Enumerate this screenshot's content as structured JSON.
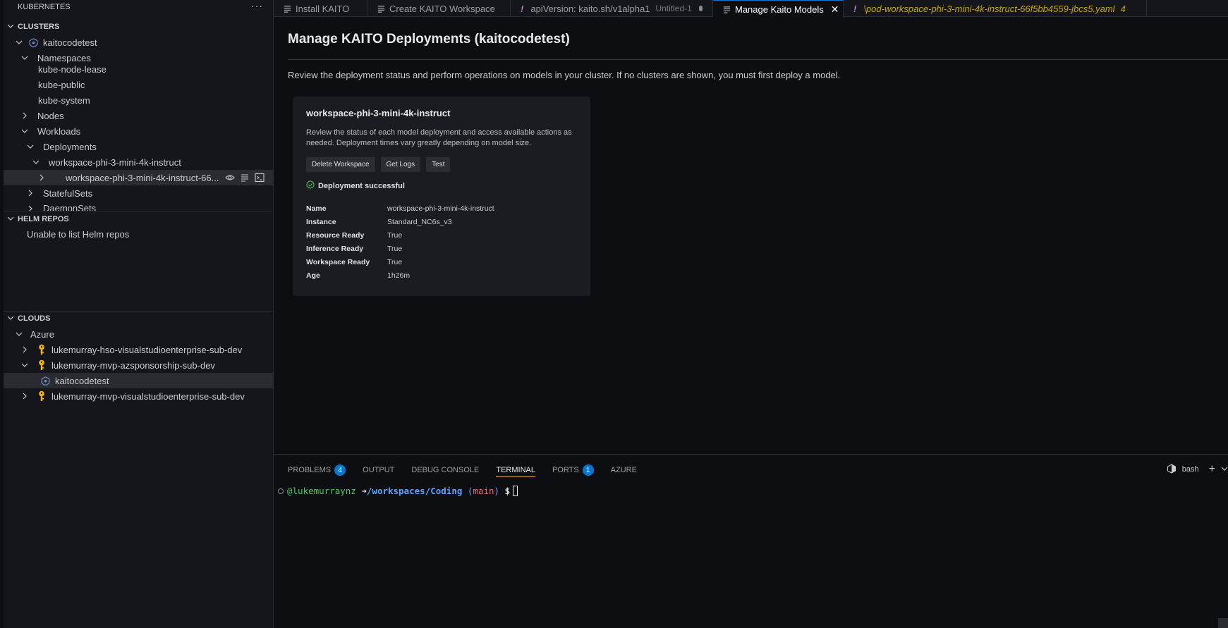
{
  "sidebar": {
    "header": "KUBERNETES",
    "more": "···",
    "clusters": {
      "title": "CLUSTERS",
      "items": [
        {
          "label": "kaitocodetest"
        },
        {
          "label": "Namespaces"
        },
        {
          "label": "kube-node-lease"
        },
        {
          "label": "kube-public"
        },
        {
          "label": "kube-system"
        },
        {
          "label": "Nodes"
        },
        {
          "label": "Workloads"
        },
        {
          "label": "Deployments"
        },
        {
          "label": "workspace-phi-3-mini-4k-instruct"
        },
        {
          "label": "workspace-phi-3-mini-4k-instruct-66..."
        },
        {
          "label": "StatefulSets"
        },
        {
          "label": "DaemonSets"
        }
      ]
    },
    "helm": {
      "title": "HELM REPOS",
      "message": "Unable to list Helm repos"
    },
    "clouds": {
      "title": "CLOUDS",
      "items": [
        {
          "label": "Azure"
        },
        {
          "label": "lukemurray-hso-visualstudioenterprise-sub-dev"
        },
        {
          "label": "lukemurray-mvp-azsponsorship-sub-dev"
        },
        {
          "label": "kaitocodetest"
        },
        {
          "label": "lukemurray-mvp-visualstudioenterprise-sub-dev"
        }
      ]
    }
  },
  "tabs": [
    {
      "label": "Install KAITO"
    },
    {
      "label": "Create KAITO Workspace"
    },
    {
      "label": "apiVersion: kaito.sh/v1alpha1",
      "sub": "Untitled-1"
    },
    {
      "label": "Manage Kaito Models"
    },
    {
      "label": "\\pod-workspace-phi-3-mini-4k-instruct-66f5bb4559-jbcs5.yaml",
      "count": "4"
    }
  ],
  "main": {
    "title": "Manage KAITO Deployments (kaitocodetest)",
    "intro": "Review the deployment status and perform operations on models in your cluster. If no clusters are shown, you must first deploy a model.",
    "card": {
      "title": "workspace-phi-3-mini-4k-instruct",
      "description": "Review the status of each model deployment and access available actions as needed. Deployment times vary greatly depending on model size.",
      "buttons": [
        "Delete Workspace",
        "Get Logs",
        "Test"
      ],
      "status": "Deployment successful",
      "details": [
        {
          "key": "Name",
          "value": "workspace-phi-3-mini-4k-instruct"
        },
        {
          "key": "Instance",
          "value": "Standard_NC6s_v3"
        },
        {
          "key": "Resource Ready",
          "value": "True"
        },
        {
          "key": "Inference Ready",
          "value": "True"
        },
        {
          "key": "Workspace Ready",
          "value": "True"
        },
        {
          "key": "Age",
          "value": "1h26m"
        }
      ]
    }
  },
  "panel": {
    "tabs": [
      {
        "label": "PROBLEMS",
        "badge": "4"
      },
      {
        "label": "OUTPUT"
      },
      {
        "label": "DEBUG CONSOLE"
      },
      {
        "label": "TERMINAL"
      },
      {
        "label": "PORTS",
        "badge": "1"
      },
      {
        "label": "AZURE"
      }
    ],
    "shell": "bash",
    "terminal": {
      "user": "@lukemurraynz",
      "arrow": "➜",
      "path": "/workspaces/Coding",
      "branch": "main",
      "prompt": "$"
    }
  },
  "colors": {
    "accent": "#0078d4",
    "active_tab_underline": "#e8a44a",
    "success": "#4ec95a",
    "warning": "#cca700"
  }
}
